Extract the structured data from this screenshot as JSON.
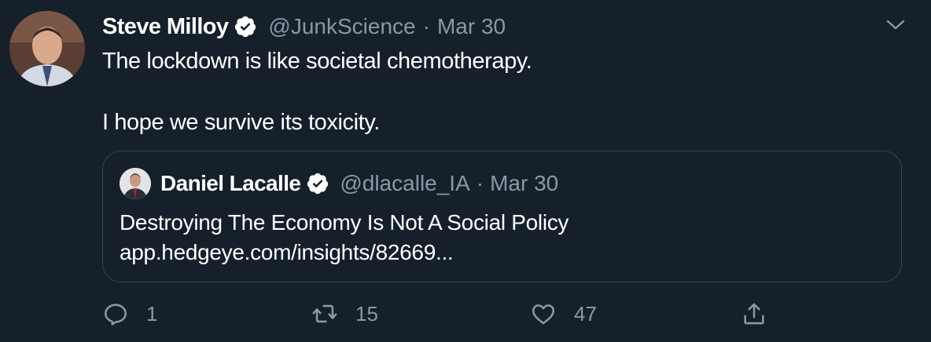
{
  "tweet": {
    "author_name": "Steve Milloy",
    "author_handle": "@JunkScience",
    "separator": "·",
    "date": "Mar 30",
    "text": "The lockdown is like societal chemotherapy.\n\nI hope we survive its toxicity."
  },
  "quoted": {
    "author_name": "Daniel Lacalle",
    "author_handle": "@dlacalle_IA",
    "separator": "·",
    "date": "Mar 30",
    "title": "Destroying The Economy Is Not A Social Policy",
    "link": "app.hedgeye.com/insights/82669..."
  },
  "actions": {
    "reply_count": "1",
    "retweet_count": "15",
    "like_count": "47"
  },
  "colors": {
    "background": "#15202b",
    "secondary_text": "#8899a6",
    "border": "#38444d",
    "verified": "#ffffff"
  },
  "icons": [
    "verified-badge-icon",
    "chevron-down-icon",
    "reply-icon",
    "retweet-icon",
    "like-icon",
    "share-icon"
  ]
}
